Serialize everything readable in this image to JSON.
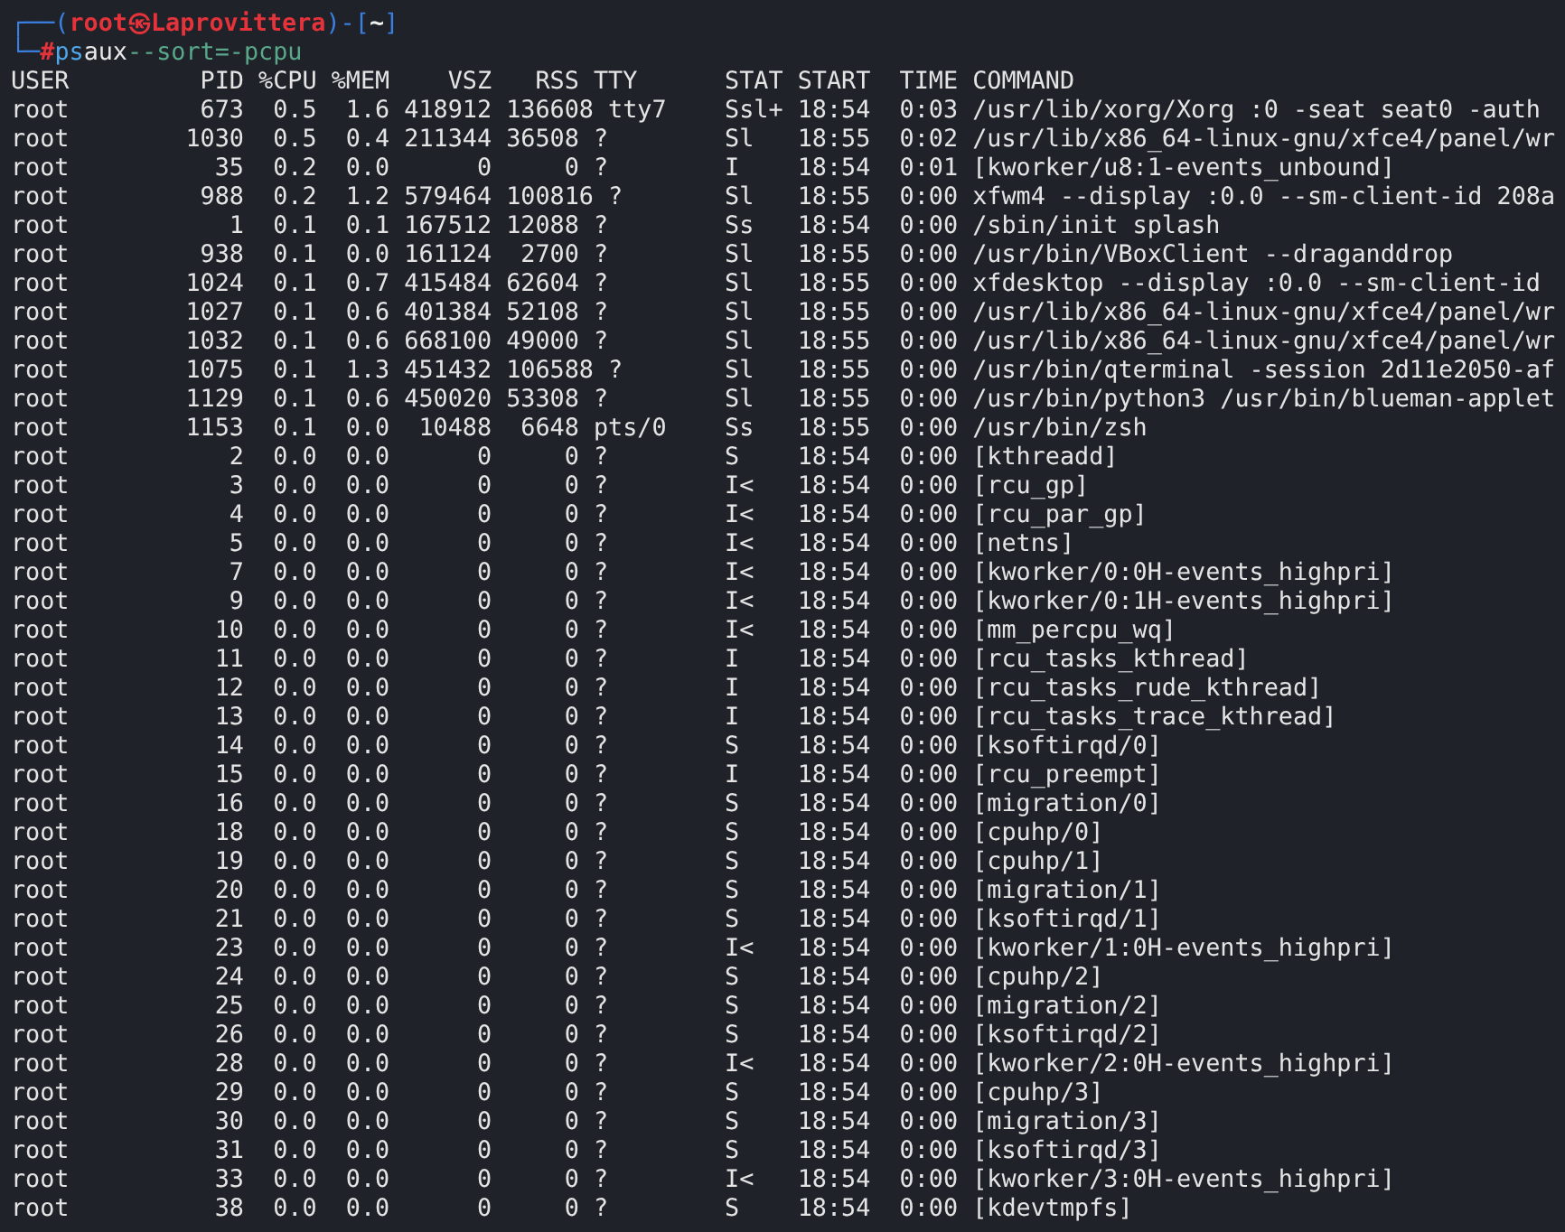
{
  "prompt": {
    "line_1": [
      {
        "text": "┌──(",
        "kind": "frame"
      },
      {
        "text": "root㉿Laprovittera",
        "kind": "userhost"
      },
      {
        "text": ")-[",
        "kind": "frame"
      },
      {
        "text": "~",
        "kind": "cwd"
      },
      {
        "text": "]",
        "kind": "frame"
      }
    ],
    "line_2": [
      {
        "text": "└─",
        "kind": "frame"
      },
      {
        "text": "#",
        "kind": "symbol"
      },
      {
        "text": "ps",
        "kind": "program"
      },
      {
        "text": "aux",
        "kind": "arg"
      },
      {
        "text": "--sort=-pcpu",
        "kind": "option"
      }
    ]
  },
  "header": [
    "USER",
    "PID",
    "%CPU",
    "%MEM",
    "VSZ",
    "RSS",
    "TTY",
    "STAT",
    "START",
    "TIME",
    "COMMAND"
  ],
  "rows": [
    {
      "user": "root",
      "pid": "673",
      "cpu": "0.5",
      "mem": "1.6",
      "vsz": "418912",
      "rss": "136608",
      "tty": "tty7",
      "stat": "Ssl+",
      "start": "18:54",
      "time": "0:03",
      "command": "/usr/lib/xorg/Xorg :0 -seat seat0 -auth"
    },
    {
      "user": "root",
      "pid": "1030",
      "cpu": "0.5",
      "mem": "0.4",
      "vsz": "211344",
      "rss": "36508",
      "tty": "?",
      "stat": "Sl",
      "start": "18:55",
      "time": "0:02",
      "command": "/usr/lib/x86_64-linux-gnu/xfce4/panel/wr"
    },
    {
      "user": "root",
      "pid": "35",
      "cpu": "0.2",
      "mem": "0.0",
      "vsz": "0",
      "rss": "0",
      "tty": "?",
      "stat": "I",
      "start": "18:54",
      "time": "0:01",
      "command": "[kworker/u8:1-events_unbound]"
    },
    {
      "user": "root",
      "pid": "988",
      "cpu": "0.2",
      "mem": "1.2",
      "vsz": "579464",
      "rss": "100816",
      "tty": "?",
      "stat": "Sl",
      "start": "18:55",
      "time": "0:00",
      "command": "xfwm4 --display :0.0 --sm-client-id 208a"
    },
    {
      "user": "root",
      "pid": "1",
      "cpu": "0.1",
      "mem": "0.1",
      "vsz": "167512",
      "rss": "12088",
      "tty": "?",
      "stat": "Ss",
      "start": "18:54",
      "time": "0:00",
      "command": "/sbin/init splash"
    },
    {
      "user": "root",
      "pid": "938",
      "cpu": "0.1",
      "mem": "0.0",
      "vsz": "161124",
      "rss": "2700",
      "tty": "?",
      "stat": "Sl",
      "start": "18:55",
      "time": "0:00",
      "command": "/usr/bin/VBoxClient --draganddrop"
    },
    {
      "user": "root",
      "pid": "1024",
      "cpu": "0.1",
      "mem": "0.7",
      "vsz": "415484",
      "rss": "62604",
      "tty": "?",
      "stat": "Sl",
      "start": "18:55",
      "time": "0:00",
      "command": "xfdesktop --display :0.0 --sm-client-id"
    },
    {
      "user": "root",
      "pid": "1027",
      "cpu": "0.1",
      "mem": "0.6",
      "vsz": "401384",
      "rss": "52108",
      "tty": "?",
      "stat": "Sl",
      "start": "18:55",
      "time": "0:00",
      "command": "/usr/lib/x86_64-linux-gnu/xfce4/panel/wr"
    },
    {
      "user": "root",
      "pid": "1032",
      "cpu": "0.1",
      "mem": "0.6",
      "vsz": "668100",
      "rss": "49000",
      "tty": "?",
      "stat": "Sl",
      "start": "18:55",
      "time": "0:00",
      "command": "/usr/lib/x86_64-linux-gnu/xfce4/panel/wr"
    },
    {
      "user": "root",
      "pid": "1075",
      "cpu": "0.1",
      "mem": "1.3",
      "vsz": "451432",
      "rss": "106588",
      "tty": "?",
      "stat": "Sl",
      "start": "18:55",
      "time": "0:00",
      "command": "/usr/bin/qterminal -session 2d11e2050-af"
    },
    {
      "user": "root",
      "pid": "1129",
      "cpu": "0.1",
      "mem": "0.6",
      "vsz": "450020",
      "rss": "53308",
      "tty": "?",
      "stat": "Sl",
      "start": "18:55",
      "time": "0:00",
      "command": "/usr/bin/python3 /usr/bin/blueman-applet"
    },
    {
      "user": "root",
      "pid": "1153",
      "cpu": "0.1",
      "mem": "0.0",
      "vsz": "10488",
      "rss": "6648",
      "tty": "pts/0",
      "stat": "Ss",
      "start": "18:55",
      "time": "0:00",
      "command": "/usr/bin/zsh"
    },
    {
      "user": "root",
      "pid": "2",
      "cpu": "0.0",
      "mem": "0.0",
      "vsz": "0",
      "rss": "0",
      "tty": "?",
      "stat": "S",
      "start": "18:54",
      "time": "0:00",
      "command": "[kthreadd]"
    },
    {
      "user": "root",
      "pid": "3",
      "cpu": "0.0",
      "mem": "0.0",
      "vsz": "0",
      "rss": "0",
      "tty": "?",
      "stat": "I<",
      "start": "18:54",
      "time": "0:00",
      "command": "[rcu_gp]"
    },
    {
      "user": "root",
      "pid": "4",
      "cpu": "0.0",
      "mem": "0.0",
      "vsz": "0",
      "rss": "0",
      "tty": "?",
      "stat": "I<",
      "start": "18:54",
      "time": "0:00",
      "command": "[rcu_par_gp]"
    },
    {
      "user": "root",
      "pid": "5",
      "cpu": "0.0",
      "mem": "0.0",
      "vsz": "0",
      "rss": "0",
      "tty": "?",
      "stat": "I<",
      "start": "18:54",
      "time": "0:00",
      "command": "[netns]"
    },
    {
      "user": "root",
      "pid": "7",
      "cpu": "0.0",
      "mem": "0.0",
      "vsz": "0",
      "rss": "0",
      "tty": "?",
      "stat": "I<",
      "start": "18:54",
      "time": "0:00",
      "command": "[kworker/0:0H-events_highpri]"
    },
    {
      "user": "root",
      "pid": "9",
      "cpu": "0.0",
      "mem": "0.0",
      "vsz": "0",
      "rss": "0",
      "tty": "?",
      "stat": "I<",
      "start": "18:54",
      "time": "0:00",
      "command": "[kworker/0:1H-events_highpri]"
    },
    {
      "user": "root",
      "pid": "10",
      "cpu": "0.0",
      "mem": "0.0",
      "vsz": "0",
      "rss": "0",
      "tty": "?",
      "stat": "I<",
      "start": "18:54",
      "time": "0:00",
      "command": "[mm_percpu_wq]"
    },
    {
      "user": "root",
      "pid": "11",
      "cpu": "0.0",
      "mem": "0.0",
      "vsz": "0",
      "rss": "0",
      "tty": "?",
      "stat": "I",
      "start": "18:54",
      "time": "0:00",
      "command": "[rcu_tasks_kthread]"
    },
    {
      "user": "root",
      "pid": "12",
      "cpu": "0.0",
      "mem": "0.0",
      "vsz": "0",
      "rss": "0",
      "tty": "?",
      "stat": "I",
      "start": "18:54",
      "time": "0:00",
      "command": "[rcu_tasks_rude_kthread]"
    },
    {
      "user": "root",
      "pid": "13",
      "cpu": "0.0",
      "mem": "0.0",
      "vsz": "0",
      "rss": "0",
      "tty": "?",
      "stat": "I",
      "start": "18:54",
      "time": "0:00",
      "command": "[rcu_tasks_trace_kthread]"
    },
    {
      "user": "root",
      "pid": "14",
      "cpu": "0.0",
      "mem": "0.0",
      "vsz": "0",
      "rss": "0",
      "tty": "?",
      "stat": "S",
      "start": "18:54",
      "time": "0:00",
      "command": "[ksoftirqd/0]"
    },
    {
      "user": "root",
      "pid": "15",
      "cpu": "0.0",
      "mem": "0.0",
      "vsz": "0",
      "rss": "0",
      "tty": "?",
      "stat": "I",
      "start": "18:54",
      "time": "0:00",
      "command": "[rcu_preempt]"
    },
    {
      "user": "root",
      "pid": "16",
      "cpu": "0.0",
      "mem": "0.0",
      "vsz": "0",
      "rss": "0",
      "tty": "?",
      "stat": "S",
      "start": "18:54",
      "time": "0:00",
      "command": "[migration/0]"
    },
    {
      "user": "root",
      "pid": "18",
      "cpu": "0.0",
      "mem": "0.0",
      "vsz": "0",
      "rss": "0",
      "tty": "?",
      "stat": "S",
      "start": "18:54",
      "time": "0:00",
      "command": "[cpuhp/0]"
    },
    {
      "user": "root",
      "pid": "19",
      "cpu": "0.0",
      "mem": "0.0",
      "vsz": "0",
      "rss": "0",
      "tty": "?",
      "stat": "S",
      "start": "18:54",
      "time": "0:00",
      "command": "[cpuhp/1]"
    },
    {
      "user": "root",
      "pid": "20",
      "cpu": "0.0",
      "mem": "0.0",
      "vsz": "0",
      "rss": "0",
      "tty": "?",
      "stat": "S",
      "start": "18:54",
      "time": "0:00",
      "command": "[migration/1]"
    },
    {
      "user": "root",
      "pid": "21",
      "cpu": "0.0",
      "mem": "0.0",
      "vsz": "0",
      "rss": "0",
      "tty": "?",
      "stat": "S",
      "start": "18:54",
      "time": "0:00",
      "command": "[ksoftirqd/1]"
    },
    {
      "user": "root",
      "pid": "23",
      "cpu": "0.0",
      "mem": "0.0",
      "vsz": "0",
      "rss": "0",
      "tty": "?",
      "stat": "I<",
      "start": "18:54",
      "time": "0:00",
      "command": "[kworker/1:0H-events_highpri]"
    },
    {
      "user": "root",
      "pid": "24",
      "cpu": "0.0",
      "mem": "0.0",
      "vsz": "0",
      "rss": "0",
      "tty": "?",
      "stat": "S",
      "start": "18:54",
      "time": "0:00",
      "command": "[cpuhp/2]"
    },
    {
      "user": "root",
      "pid": "25",
      "cpu": "0.0",
      "mem": "0.0",
      "vsz": "0",
      "rss": "0",
      "tty": "?",
      "stat": "S",
      "start": "18:54",
      "time": "0:00",
      "command": "[migration/2]"
    },
    {
      "user": "root",
      "pid": "26",
      "cpu": "0.0",
      "mem": "0.0",
      "vsz": "0",
      "rss": "0",
      "tty": "?",
      "stat": "S",
      "start": "18:54",
      "time": "0:00",
      "command": "[ksoftirqd/2]"
    },
    {
      "user": "root",
      "pid": "28",
      "cpu": "0.0",
      "mem": "0.0",
      "vsz": "0",
      "rss": "0",
      "tty": "?",
      "stat": "I<",
      "start": "18:54",
      "time": "0:00",
      "command": "[kworker/2:0H-events_highpri]"
    },
    {
      "user": "root",
      "pid": "29",
      "cpu": "0.0",
      "mem": "0.0",
      "vsz": "0",
      "rss": "0",
      "tty": "?",
      "stat": "S",
      "start": "18:54",
      "time": "0:00",
      "command": "[cpuhp/3]"
    },
    {
      "user": "root",
      "pid": "30",
      "cpu": "0.0",
      "mem": "0.0",
      "vsz": "0",
      "rss": "0",
      "tty": "?",
      "stat": "S",
      "start": "18:54",
      "time": "0:00",
      "command": "[migration/3]"
    },
    {
      "user": "root",
      "pid": "31",
      "cpu": "0.0",
      "mem": "0.0",
      "vsz": "0",
      "rss": "0",
      "tty": "?",
      "stat": "S",
      "start": "18:54",
      "time": "0:00",
      "command": "[ksoftirqd/3]"
    },
    {
      "user": "root",
      "pid": "33",
      "cpu": "0.0",
      "mem": "0.0",
      "vsz": "0",
      "rss": "0",
      "tty": "?",
      "stat": "I<",
      "start": "18:54",
      "time": "0:00",
      "command": "[kworker/3:0H-events_highpri]"
    },
    {
      "user": "root",
      "pid": "38",
      "cpu": "0.0",
      "mem": "0.0",
      "vsz": "0",
      "rss": "0",
      "tty": "?",
      "stat": "S",
      "start": "18:54",
      "time": "0:00",
      "command": "[kdevtmpfs]"
    }
  ]
}
